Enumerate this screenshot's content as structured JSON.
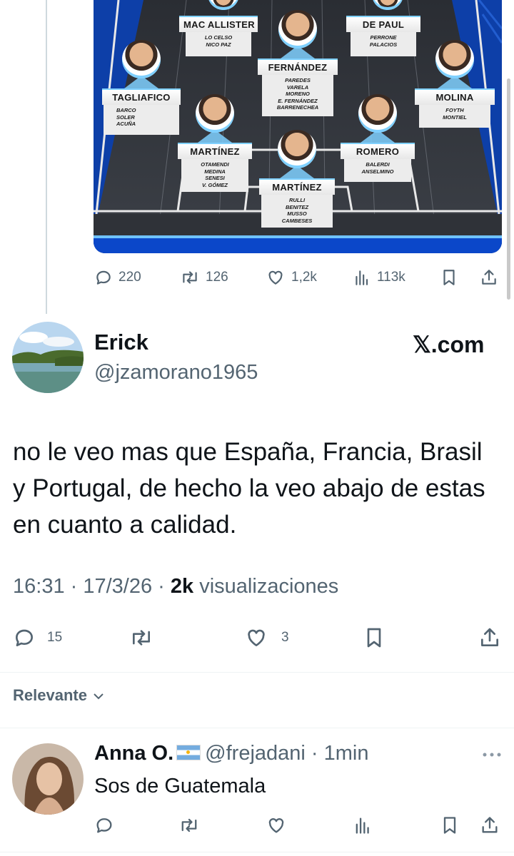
{
  "lineup": {
    "players": [
      {
        "name": "MAC ALLISTER",
        "subs": "LO CELSO\nNICO PAZ"
      },
      {
        "name": "DE PAUL",
        "subs": "PERRONE\nPALACIOS"
      },
      {
        "name": "FERNÁNDEZ",
        "subs": "PAREDES\nVARELA\nMORENO\nE. FERNÁNDEZ\nBARRENECHEA"
      },
      {
        "name": "TAGLIAFICO",
        "subs": "BARCO\nSOLER\nACUÑA"
      },
      {
        "name": "MOLINA",
        "subs": "FOYTH\nMONTIEL"
      },
      {
        "name": "MARTÍNEZ",
        "subs": "OTAMENDI\nMEDINA\nSENESI\nV. GÓMEZ"
      },
      {
        "name": "ROMERO",
        "subs": "BALERDI\nANSELMINO"
      },
      {
        "name": "MARTÍNEZ",
        "subs": "RULLI\nBENITEZ\nMUSSO\nCAMBESES"
      }
    ]
  },
  "quoted_actions": {
    "replies": "220",
    "reposts": "126",
    "likes": "1,2k",
    "views": "113k"
  },
  "tweet": {
    "author_name": "Erick",
    "handle": "@jzamorano1965",
    "brand": "𝕏.com",
    "text": "no le veo mas que España, Francia, Brasil y Portugal, de hecho la veo abajo de estas en cuanto a calidad.",
    "time": "16:31",
    "date": "17/3/26",
    "views_count": "2k",
    "views_label": "visualizaciones",
    "replies": "15",
    "likes": "3"
  },
  "sort": {
    "label": "Relevante"
  },
  "reply": {
    "name": "Anna O.",
    "handle": "@frejadani",
    "time": "1min",
    "text": "Sos de Guatemala"
  }
}
